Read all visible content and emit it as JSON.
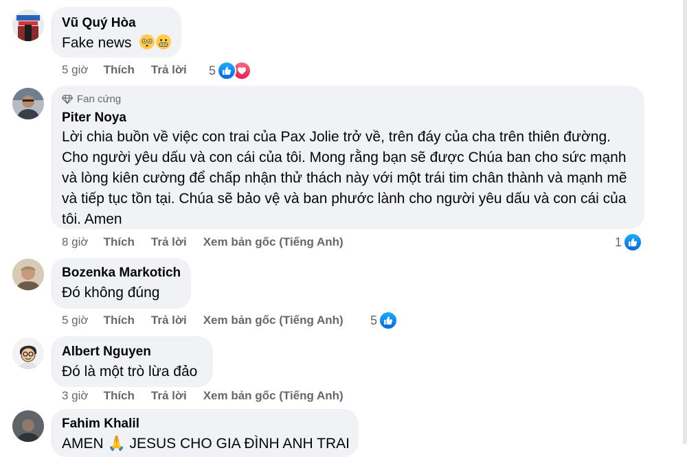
{
  "comments": [
    {
      "author": "Vũ Quý Hòa",
      "text": "Fake news",
      "emojis": [
        "flushed-face",
        "grimacing-face"
      ],
      "time": "5 giờ",
      "like_label": "Thích",
      "reply_label": "Trả lời",
      "reaction_count": "5",
      "reactions": [
        "like",
        "love"
      ]
    },
    {
      "badge": "Fan cứng",
      "author": "Piter Noya",
      "text": "Lời chia buồn về việc con trai của Pax Jolie trở về, trên đáy của cha trên thiên đường. Cho người yêu dấu và con cái của tôi. Mong rằng bạn sẽ được Chúa ban cho sức mạnh và lòng kiên cường để chấp nhận thử thách này với một trái tim chân thành và mạnh mẽ và tiếp tục tồn tại. Chúa sẽ bảo vệ và ban phước lành cho người yêu dấu và con cái của tôi. Amen",
      "time": "8 giờ",
      "like_label": "Thích",
      "reply_label": "Trả lời",
      "see_original": "Xem bản gốc (Tiếng Anh)",
      "reaction_count": "1",
      "reactions": [
        "like"
      ]
    },
    {
      "author": "Bozenka Markotich",
      "text": "Đó không đúng",
      "time": "5 giờ",
      "like_label": "Thích",
      "reply_label": "Trả lời",
      "see_original": "Xem bản gốc (Tiếng Anh)",
      "reaction_count": "5",
      "reactions": [
        "like"
      ]
    },
    {
      "author": "Albert Nguyen",
      "text": "Đó là một trò lừa đảo",
      "time": "3 giờ",
      "like_label": "Thích",
      "reply_label": "Trả lời",
      "see_original": "Xem bản gốc (Tiếng Anh)"
    },
    {
      "author": "Fahim Khalil",
      "text": "AMEN 🙏 JESUS CHO GIA ĐÌNH ANH TRAI"
    }
  ],
  "colors": {
    "bubble": "#f0f2f5",
    "meta_text": "#65676b",
    "like_blue": "#0668e1",
    "love_red": "#e61e4d"
  }
}
